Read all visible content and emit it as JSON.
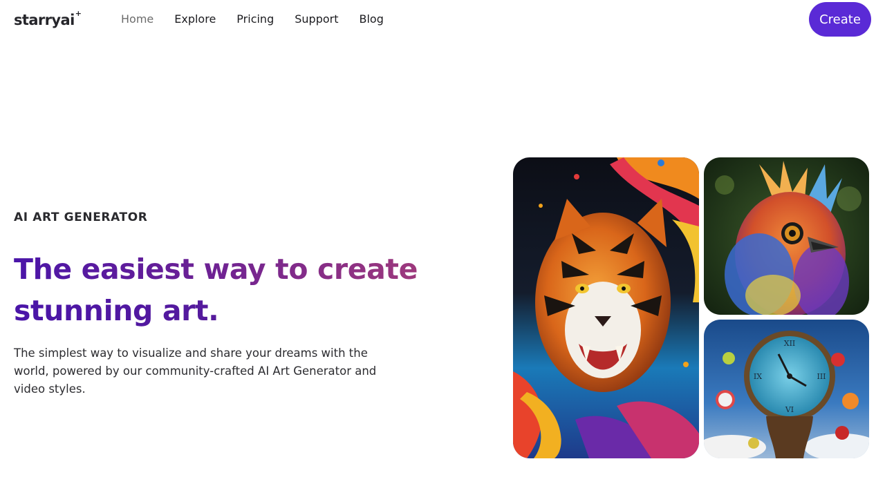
{
  "brand": {
    "logo_text": "starryai",
    "logo_star": "+"
  },
  "nav": {
    "items": [
      {
        "label": "Home",
        "active": true
      },
      {
        "label": "Explore",
        "active": false
      },
      {
        "label": "Pricing",
        "active": false
      },
      {
        "label": "Support",
        "active": false
      },
      {
        "label": "Blog",
        "active": false
      }
    ],
    "cta_label": "Create"
  },
  "hero": {
    "eyebrow": "AI ART GENERATOR",
    "headline_line1": "The easiest way to create",
    "headline_line2": "stunning art.",
    "subtext": "The simplest way to visualize and share your dreams with the world, powered by our community-crafted AI Art Generator and video styles."
  },
  "gallery": {
    "images": [
      {
        "name": "tiger-paint-splash-image"
      },
      {
        "name": "colorful-owl-bird-image"
      },
      {
        "name": "melting-clock-surreal-image"
      }
    ]
  },
  "colors": {
    "accent": "#5a2ad6",
    "headline_start": "#4a15a8",
    "headline_end": "#a13a7a",
    "nav_active": "#6b6b6b",
    "text": "#1f1f24"
  }
}
